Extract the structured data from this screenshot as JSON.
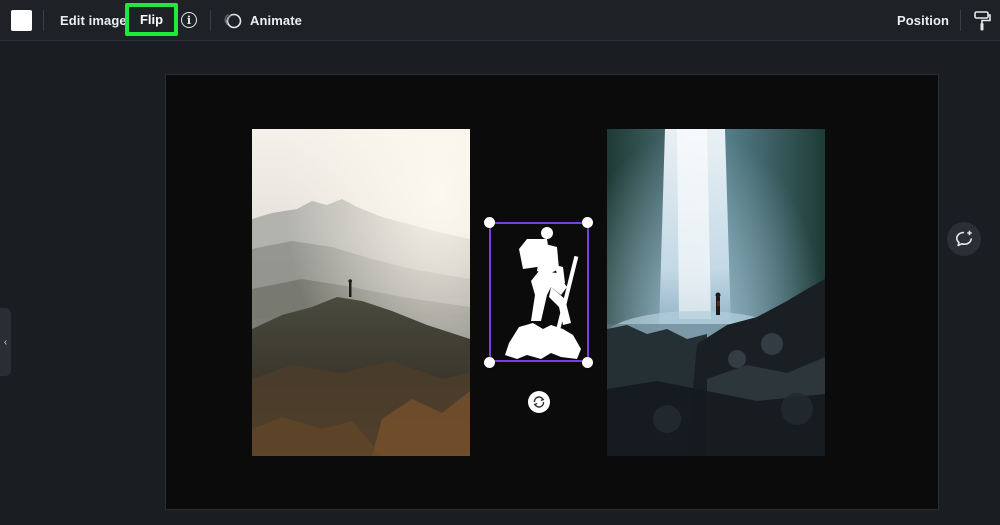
{
  "toolbar": {
    "edit_image_label": "Edit image",
    "flip_label": "Flip",
    "info_glyph": "i",
    "animate_label": "Animate",
    "position_label": "Position",
    "swatch_color": "#ffffff",
    "highlight_color": "#22e83a"
  },
  "canvas": {
    "photos": [
      {
        "subject": "hiker-on-mountain-ridge"
      },
      {
        "subject": "hiker-at-waterfall"
      }
    ],
    "selected_element": "hiker-silhouette",
    "selection_color": "#7a3fe0"
  },
  "icons": {
    "info": "info-icon",
    "animate": "animate-icon",
    "paint_format": "paint-roller-icon",
    "rotate": "rotate-icon",
    "side_panel": "chevron-left-icon",
    "comment": "add-comment-icon"
  },
  "side_tab_glyph": "‹"
}
